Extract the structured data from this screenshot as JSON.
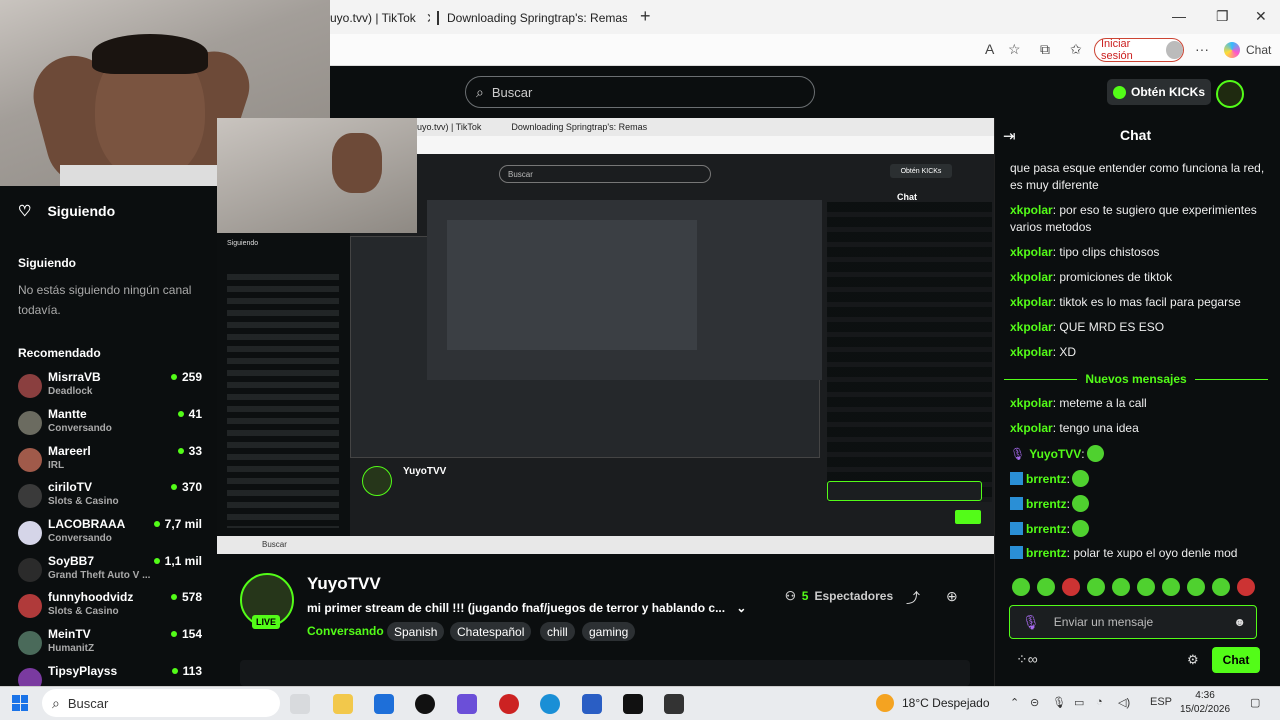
{
  "browser": {
    "tabs": [
      {
        "label": "uyo.tvv) | TikTok"
      },
      {
        "label": "Downloading Springtrap's: Remast"
      }
    ],
    "new_tab": "+",
    "login_label": "Iniciar sesión",
    "copilot_label": "Chat"
  },
  "kick": {
    "search_placeholder": "Buscar",
    "kicks_button": "Obtén KICKs"
  },
  "sidebar": {
    "following_header": "Siguiendo",
    "following_section": "Siguiendo",
    "empty_text": "No estás siguiendo ningún canal todavía.",
    "recommended_section": "Recomendado",
    "channels": [
      {
        "name": "MisrraVB",
        "category": "Deadlock",
        "viewers": "259"
      },
      {
        "name": "Mantte",
        "category": "Conversando",
        "viewers": "41"
      },
      {
        "name": "Mareerl",
        "category": "IRL",
        "viewers": "33"
      },
      {
        "name": "ciriloTV",
        "category": "Slots & Casino",
        "viewers": "370"
      },
      {
        "name": "LACOBRAAA",
        "category": "Conversando",
        "viewers": "7,7 mil"
      },
      {
        "name": "SoyBB7",
        "category": "Grand Theft Auto V ...",
        "viewers": "1,1 mil"
      },
      {
        "name": "funnyhoodvidz",
        "category": "Slots & Casino",
        "viewers": "578"
      },
      {
        "name": "MeinTV",
        "category": "HumanitZ",
        "viewers": "154"
      },
      {
        "name": "TipsyPlayss",
        "category": "",
        "viewers": "113"
      }
    ]
  },
  "stream": {
    "name": "YuyoTVV",
    "live": "LIVE",
    "title": "mi primer stream de chill !!! (jugando fnaf/juegos de terror y hablando c...",
    "category": "Conversando",
    "tags": [
      "Spanish",
      "Chatespañol",
      "chill",
      "gaming"
    ],
    "viewers_count": "5",
    "viewers_label": "Espectadores"
  },
  "chat": {
    "title": "Chat",
    "messages_top": [
      {
        "user": "",
        "text": "que pasa esque entender como funciona la red, es muy diferente"
      },
      {
        "user": "xkpolar",
        "text": ": por eso te sugiero que experimientes varios metodos"
      },
      {
        "user": "xkpolar",
        "text": ": tipo clips chistosos"
      },
      {
        "user": "xkpolar",
        "text": ": promiciones de tiktok"
      },
      {
        "user": "xkpolar",
        "text": ": tiktok es lo mas facil para pegarse"
      },
      {
        "user": "xkpolar",
        "text": ": QUE MRD ES ESO"
      },
      {
        "user": "xkpolar",
        "text": ": XD"
      }
    ],
    "new_messages": "Nuevos mensajes",
    "messages_bottom": [
      {
        "user": "xkpolar",
        "text": ": meteme a la call"
      },
      {
        "user": "xkpolar",
        "text": ": tengo una idea"
      },
      {
        "user": "YuyoTVV",
        "text": ":"
      },
      {
        "user": "brrentz",
        "text": ":"
      },
      {
        "user": "brrentz",
        "text": ":"
      },
      {
        "user": "brrentz",
        "text": ":"
      },
      {
        "user": "brrentz",
        "text": ": polar te xupo el oyo denle mod"
      }
    ],
    "input_placeholder": "Enviar un mensaje",
    "send_button": "Chat"
  },
  "video": {
    "tab1": "uyo.tvv) | TikTok",
    "tab2": "Downloading Springtrap's: Remas",
    "search": "Buscar",
    "chat_title": "Chat",
    "kicks": "Obtén KICKs",
    "following": "Siguiendo",
    "streamer": "YuyoTVV",
    "taskbar_search": "Buscar"
  },
  "taskbar": {
    "search_placeholder": "Buscar",
    "weather": "18°C Despejado",
    "lang": "ESP",
    "time": "4:36",
    "date": "15/02/2026"
  }
}
